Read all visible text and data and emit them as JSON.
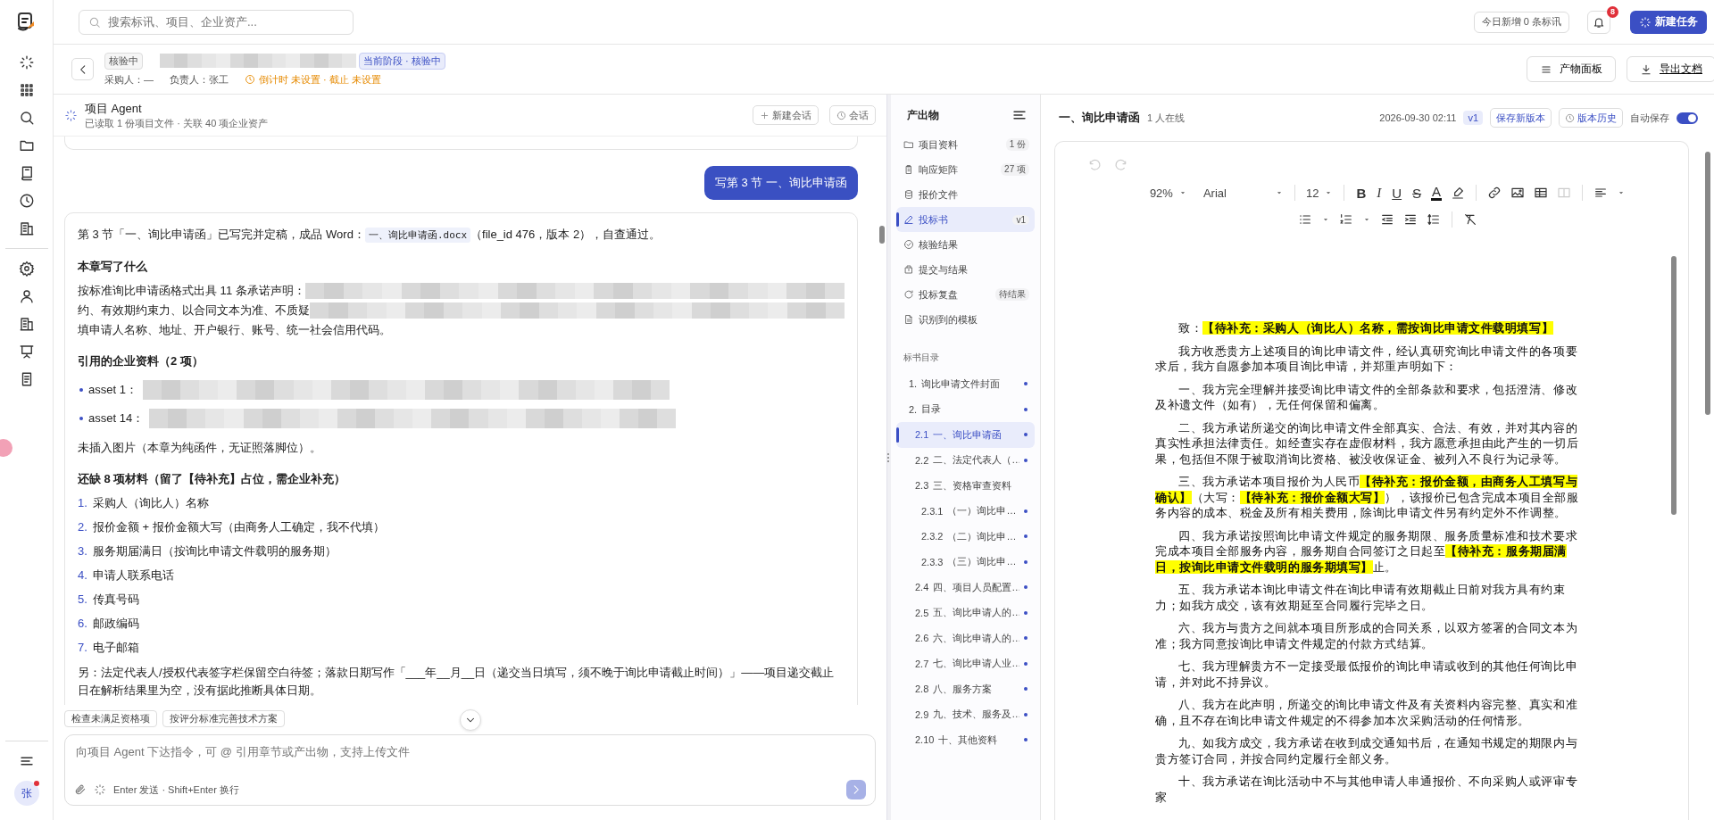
{
  "topbar": {
    "search": {
      "placeholder": "搜索标讯、项目、企业资产..."
    },
    "today": "今日新增 0 条标讯",
    "notifications": "8",
    "new_task": "新建任务"
  },
  "header": {
    "status_tag": "核验中",
    "stage_tag": "当前阶段 · 核验中",
    "buyer": "采购人：—",
    "owner": "负责人：张工",
    "countdown": "倒计时 未设置 · 截止 未设置",
    "buttons": [
      "产物面板",
      "导出文档"
    ]
  },
  "rail": {
    "avatar": "张"
  },
  "agent": {
    "title": "项目 Agent",
    "subtitle": "已读取 1 份项目文件 · 关联 40 项企业资产",
    "buttons": [
      "新建会话",
      "会话"
    ],
    "user_message": "写第 3 节 一、询比申请函",
    "blocks": [
      {
        "kind": "text",
        "parts": [
          {
            "kind": "plain",
            "text": "第 3 节「一、询比申请函」已写完并定稿，成品 Word："
          },
          {
            "kind": "code",
            "text": "一、询比申请函.docx"
          },
          {
            "kind": "plain",
            "text": "（file_id 476，版本 2），自查通过。"
          }
        ]
      },
      {
        "kind": "heading",
        "text": "本章写了什么"
      },
      {
        "kind": "lines",
        "items": [
          {
            "text": "按标准询比申请函格式出具 11 条承诺声明：",
            "blurred": true
          },
          {
            "text": "约、有效期约束力、以合同文本为准、不质疑",
            "blurred": true
          },
          {
            "text": "填申请人名称、地址、开户银行、账号、统一社会信用代码。",
            "blurred": false
          }
        ]
      },
      {
        "kind": "heading",
        "text": "引用的企业资料（2 项）"
      },
      {
        "kind": "bullets",
        "items": [
          {
            "text": "asset 1：",
            "blurred": true
          },
          {
            "text": "asset 14：",
            "blurred": true
          }
        ]
      },
      {
        "kind": "text",
        "parts": [
          {
            "kind": "plain",
            "text": "未插入图片（本章为纯函件，无证照落脚位）。"
          }
        ]
      },
      {
        "kind": "heading",
        "text": "还缺 8 项材料（留了【待补充】占位，需企业补充）"
      },
      {
        "kind": "numbered",
        "items": [
          {
            "number": "1.",
            "text": "采购人（询比人）名称"
          },
          {
            "number": "2.",
            "text": "报价金额 + 报价金额大写（由商务人工确定，我不代填）"
          },
          {
            "number": "3.",
            "text": "服务期届满日（按询比申请文件载明的服务期）"
          },
          {
            "number": "4.",
            "text": "申请人联系电话"
          },
          {
            "number": "5.",
            "text": "传真号码"
          },
          {
            "number": "6.",
            "text": "邮政编码"
          },
          {
            "number": "7.",
            "text": "电子邮箱"
          }
        ]
      },
      {
        "kind": "text",
        "parts": [
          {
            "kind": "plain",
            "text": "另：法定代表人/授权代表签字栏保留空白待签；落款日期写作「___年__月__日（递交当日填写，须不晚于询比申请截止时间）」——项目递交截止日在解析结果里为空，没有据此推断具体日期。"
          }
        ]
      }
    ],
    "suggestions": [
      "检查未满足资格项",
      "按评分标准完善技术方案"
    ],
    "input": {
      "placeholder": "向项目 Agent 下达指令，可 @ 引用章节或产出物，支持上传文件",
      "hint": "Enter 发送 · Shift+Enter 换行"
    }
  },
  "nav": {
    "title": "产出物",
    "items": [
      {
        "label": "项目资料",
        "badge": "1 份",
        "selected": false
      },
      {
        "label": "响应矩阵",
        "badge": "27 项",
        "selected": false
      },
      {
        "label": "报价文件",
        "selected": false
      },
      {
        "label": "投标书",
        "badge": "v1",
        "selected": true
      },
      {
        "label": "核验结果",
        "selected": false
      },
      {
        "label": "提交与结果",
        "selected": false
      },
      {
        "label": "投标复盘",
        "badge": "待结果",
        "selected": false
      },
      {
        "label": "识别到的模板",
        "selected": false
      }
    ],
    "toc": {
      "title": "标书目录",
      "items": [
        {
          "number": "1.",
          "label": "询比申请文件封面",
          "done": true,
          "selected": false
        },
        {
          "number": "2.",
          "label": "目录",
          "done": true,
          "selected": false,
          "children": [
            {
              "number": "2.1",
              "label": "一、询比申请函",
              "done": true,
              "selected": true
            },
            {
              "number": "2.2",
              "label": "二、法定代表人（…",
              "done": true,
              "selected": false
            },
            {
              "number": "2.3",
              "label": "三、资格审查资料",
              "done": false,
              "selected": false,
              "children": [
                {
                  "number": "2.3.1",
                  "label": "（一）询比申…",
                  "done": true,
                  "selected": false
                },
                {
                  "number": "2.3.2",
                  "label": "（二）询比申…",
                  "done": true,
                  "selected": false
                },
                {
                  "number": "2.3.3",
                  "label": "（三）询比申…",
                  "done": true,
                  "selected": false
                }
              ]
            },
            {
              "number": "2.4",
              "label": "四、项目人员配置…",
              "done": true,
              "selected": false
            },
            {
              "number": "2.5",
              "label": "五、询比申请人的…",
              "done": true,
              "selected": false
            },
            {
              "number": "2.6",
              "label": "六、询比申请人的…",
              "done": true,
              "selected": false
            },
            {
              "number": "2.7",
              "label": "七、询比申请人业…",
              "done": true,
              "selected": false
            },
            {
              "number": "2.8",
              "label": "八、服务方案",
              "done": true,
              "selected": false
            },
            {
              "number": "2.9",
              "label": "九、技术、服务及…",
              "done": true,
              "selected": false
            },
            {
              "number": "2.10",
              "label": "十、其他资料",
              "done": true,
              "selected": false
            }
          ]
        }
      ]
    }
  },
  "doc": {
    "title": "一、询比申请函",
    "online": "1 人在线",
    "timestamp": "2026-09-30 02:11",
    "version": "v1",
    "save": "保存新版本",
    "history": "版本历史",
    "autosave": {
      "label": "自动保存",
      "on": true
    },
    "toolbar": {
      "zoom": "92%",
      "font": "Arial",
      "size": "12",
      "format": [
        {
          "kind": "bold",
          "text": "B"
        },
        {
          "kind": "italic",
          "text": "I"
        },
        {
          "kind": "underline",
          "text": "U"
        },
        {
          "kind": "strike",
          "text": "S"
        },
        {
          "kind": "color",
          "text": "A"
        }
      ]
    },
    "paragraphs": [
      [
        {
          "text": "致："
        },
        {
          "text": "【待补充：采购人（询比人）名称，需按询比申请文件载明填写】",
          "fill": true
        }
      ],
      [
        {
          "text": "我方收悉贵方上述项目的询比申请文件，经认真研究询比申请文件的各项要求后，我方自愿参加本项目询比申请，并郑重声明如下："
        }
      ],
      [
        {
          "text": "一、我方完全理解并接受询比申请文件的全部条款和要求，包括澄清、修改及补遗文件（如有），无任何保留和偏离。"
        }
      ],
      [
        {
          "text": "二、我方承诺所递交的询比申请文件全部真实、合法、有效，并对其内容的真实性承担法律责任。如经查实存在虚假材料，我方愿意承担由此产生的一切后果，包括但不限于被取消询比资格、被没收保证金、被列入不良行为记录等。"
        }
      ],
      [
        {
          "text": "三、我方承诺本项目报价为人民币"
        },
        {
          "text": "【待补充：报价金额，由商务人工填写与确认】",
          "fill": true
        },
        {
          "text": "（大写："
        },
        {
          "text": "【待补充：报价金额大写】",
          "fill": true
        },
        {
          "text": "），该报价已包含完成本项目全部服务内容的成本、税金及所有相关费用，除询比申请文件另有约定外不作调整。"
        }
      ],
      [
        {
          "text": "四、我方承诺按照询比申请文件规定的服务期限、服务质量标准和技术要求完成本项目全部服务内容，服务期自合同签订之日起至"
        },
        {
          "text": "【待补充：服务期届满日，按询比申请文件载明的服务期填写】",
          "fill": true
        },
        {
          "text": "止。"
        }
      ],
      [
        {
          "text": "五、我方承诺本询比申请文件在询比申请有效期截止日前对我方具有约束力；如我方成交，该有效期延至合同履行完毕之日。"
        }
      ],
      [
        {
          "text": "六、我方与贵方之间就本项目所形成的合同关系，以双方签署的合同文本为准；我方同意按询比申请文件规定的付款方式结算。"
        }
      ],
      [
        {
          "text": "七、我方理解贵方不一定接受最低报价的询比申请或收到的其他任何询比申请，并对此不持异议。"
        }
      ],
      [
        {
          "text": "八、我方在此声明，所递交的询比申请文件及有关资料内容完整、真实和准确，且不存在询比申请文件规定的不得参加本次采购活动的任何情形。"
        }
      ],
      [
        {
          "text": "九、如我方成交，我方承诺在收到成交通知书后，在通知书规定的期限内与贵方签订合同，并按合同约定履行全部义务。"
        }
      ],
      [
        {
          "text": "十、我方承诺在询比活动中不与其他申请人串通报价、不向采购人或评审专家"
        }
      ]
    ]
  }
}
